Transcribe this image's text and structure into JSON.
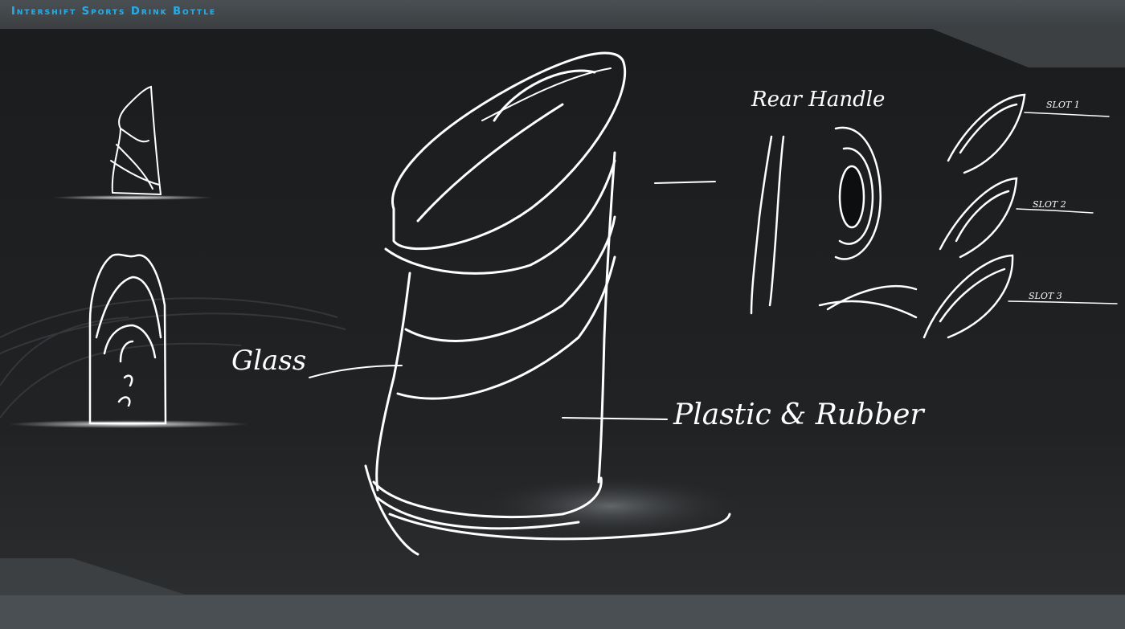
{
  "header": {
    "title": "Intershift Sports Drink Bottle"
  },
  "annotations": {
    "glass": "Glass",
    "plastic_rubber": "Plastic & Rubber",
    "rear_handle": "Rear Handle",
    "slot1": "SLOT 1",
    "slot2": "SLOT 2",
    "slot3": "SLOT 3"
  },
  "colors": {
    "title": "#2aa8e0",
    "canvas": "#1c1e20",
    "frame": "#3c4043",
    "stroke": "#ffffff"
  }
}
